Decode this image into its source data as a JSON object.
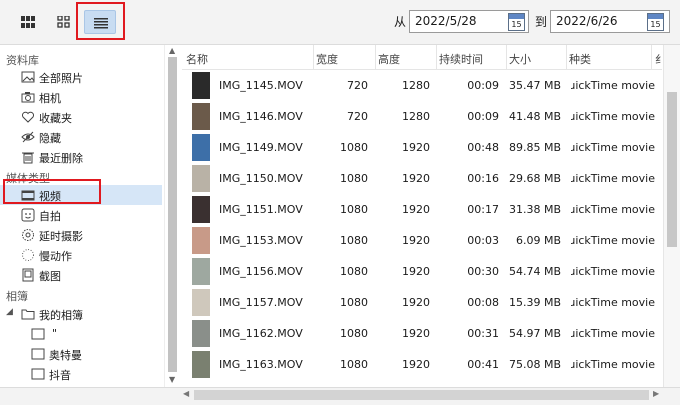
{
  "toolbar": {
    "view_buttons": [
      {
        "name": "grid-large-view-icon"
      },
      {
        "name": "grid-small-view-icon"
      },
      {
        "name": "list-view-icon",
        "active": true
      }
    ],
    "from_label": "从",
    "from_date": "2022/5/28",
    "to_label": "到",
    "to_date": "2022/6/26",
    "calendar_day": "15"
  },
  "sidebar": {
    "library_header": "资料库",
    "library_items": [
      {
        "label": "全部照片",
        "icon": "photos-icon"
      },
      {
        "label": "相机",
        "icon": "camera-icon"
      },
      {
        "label": "收藏夹",
        "icon": "heart-icon"
      },
      {
        "label": "隐藏",
        "icon": "eye-hidden-icon"
      },
      {
        "label": "最近删除",
        "icon": "trash-icon"
      }
    ],
    "media_header": "媒体类型",
    "media_items": [
      {
        "label": "视频",
        "icon": "video-icon",
        "selected": true
      },
      {
        "label": "自拍",
        "icon": "selfie-icon"
      },
      {
        "label": "延时摄影",
        "icon": "timelapse-icon"
      },
      {
        "label": "慢动作",
        "icon": "slowmo-icon"
      },
      {
        "label": "截图",
        "icon": "screenshot-icon"
      }
    ],
    "albums_header": "相簿",
    "my_albums": "我的相簿",
    "album_items": [
      "\"",
      "奥特曼",
      "抖音"
    ]
  },
  "table": {
    "headers": [
      "名称",
      "宽度",
      "高度",
      "持续时间",
      "大小",
      "种类",
      "纟"
    ],
    "rows": [
      {
        "name": "IMG_1145.MOV",
        "width": "720",
        "height": "1280",
        "duration": "00:09",
        "size": "35.47 MB",
        "kind": "QuickTime movie"
      },
      {
        "name": "IMG_1146.MOV",
        "width": "720",
        "height": "1280",
        "duration": "00:09",
        "size": "41.48 MB",
        "kind": "QuickTime movie"
      },
      {
        "name": "IMG_1149.MOV",
        "width": "1080",
        "height": "1920",
        "duration": "00:48",
        "size": "89.85 MB",
        "kind": "QuickTime movie"
      },
      {
        "name": "IMG_1150.MOV",
        "width": "1080",
        "height": "1920",
        "duration": "00:16",
        "size": "29.68 MB",
        "kind": "QuickTime movie"
      },
      {
        "name": "IMG_1151.MOV",
        "width": "1080",
        "height": "1920",
        "duration": "00:17",
        "size": "31.38 MB",
        "kind": "QuickTime movie"
      },
      {
        "name": "IMG_1153.MOV",
        "width": "1080",
        "height": "1920",
        "duration": "00:03",
        "size": "6.09 MB",
        "kind": "QuickTime movie"
      },
      {
        "name": "IMG_1156.MOV",
        "width": "1080",
        "height": "1920",
        "duration": "00:30",
        "size": "54.74 MB",
        "kind": "QuickTime movie"
      },
      {
        "name": "IMG_1157.MOV",
        "width": "1080",
        "height": "1920",
        "duration": "00:08",
        "size": "15.39 MB",
        "kind": "QuickTime movie"
      },
      {
        "name": "IMG_1162.MOV",
        "width": "1080",
        "height": "1920",
        "duration": "00:31",
        "size": "54.97 MB",
        "kind": "QuickTime movie"
      },
      {
        "name": "IMG_1163.MOV",
        "width": "1080",
        "height": "1920",
        "duration": "00:41",
        "size": "75.08 MB",
        "kind": "QuickTime movie"
      }
    ]
  },
  "colors": {
    "highlight_red": "#e0191f",
    "selection_blue": "#d6e6f7",
    "active_button": "#c8dcf2"
  }
}
